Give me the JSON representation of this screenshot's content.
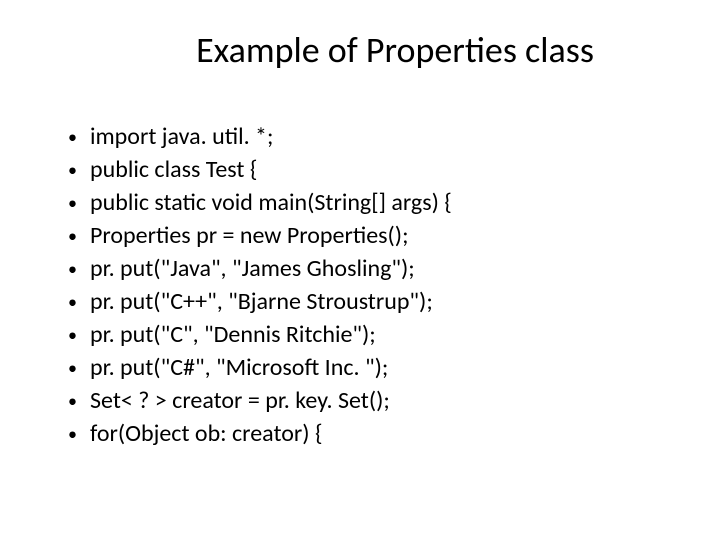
{
  "title": "Example of Properties class",
  "bullets": [
    "import java. util. *;",
    "public class Test {",
    "public static void main(String[] args) {",
    "Properties pr = new Properties();",
    "pr. put(\"Java\", \"James Ghosling\");",
    "pr. put(\"C++\", \"Bjarne Stroustrup\");",
    "pr. put(\"C\", \"Dennis Ritchie\");",
    "pr. put(\"C#\", \"Microsoft Inc. \");",
    "Set< ? > creator = pr. key. Set();",
    "for(Object ob: creator) {"
  ]
}
